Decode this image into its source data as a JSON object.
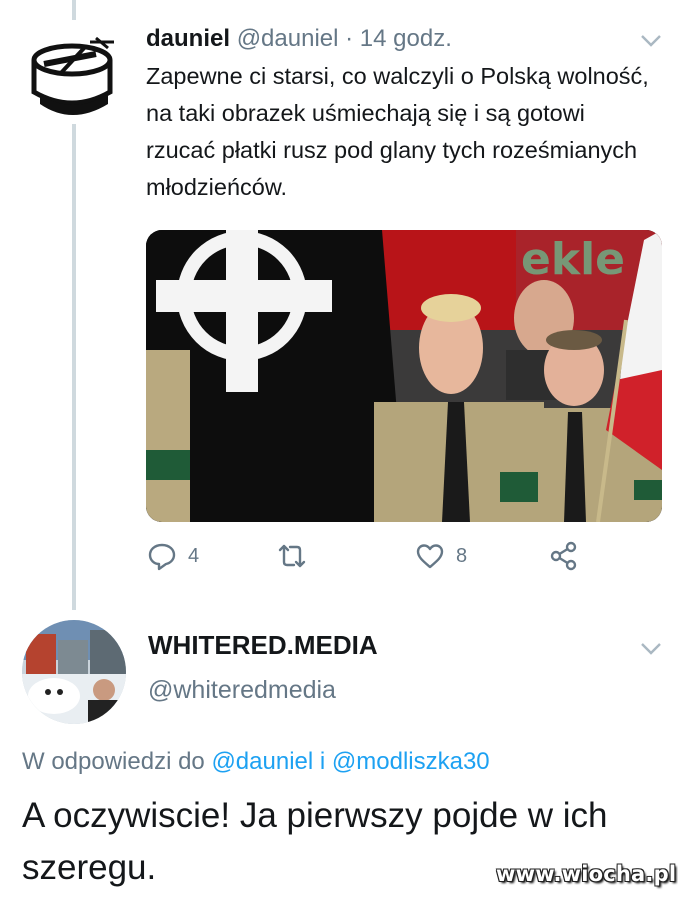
{
  "tweet1": {
    "name": "dauniel",
    "handle": "@dauniel",
    "separator": "·",
    "time": "14 godz.",
    "text": "Zapewne ci starsi, co walczyli o Polską wolność, na taki obrazek uśmiechają się i są gotowi rzucać płatki rusz pod glany tych roześmianych młodzieńców.",
    "image_alt": "photo",
    "image_banner_text": "ekle",
    "actions": {
      "reply_count": "4",
      "retweet_count": "",
      "like_count": "8"
    },
    "icons": [
      "chevron-down-icon",
      "reply-icon",
      "retweet-icon",
      "like-icon",
      "share-icon"
    ]
  },
  "tweet2": {
    "name": "WHITERED.MEDIA",
    "handle": "@whiteredmedia",
    "reply_prefix": "W odpowiedzi do",
    "reply_user1": "@dauniel",
    "reply_conj": "i",
    "reply_user2": "@modliszka30",
    "text": "A oczywiscie! Ja pierwszy pojde w ich szeregu."
  },
  "watermark": "www.wiocha.pl",
  "colors": {
    "muted": "#657786",
    "link": "#1da1f2",
    "thread_line": "#cfd9de",
    "text": "#14171a"
  }
}
